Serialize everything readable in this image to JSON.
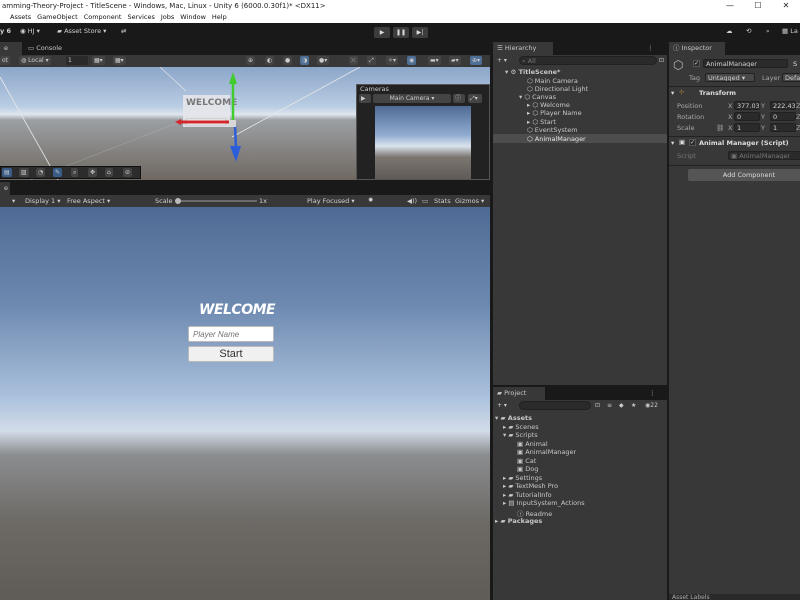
{
  "window": {
    "title": "amming-Theory-Project - TitleScene - Windows, Mac, Linux - Unity 6 (6000.0.30f1)* <DX11>",
    "controls": [
      "—",
      "☐",
      "✕"
    ]
  },
  "menu": [
    "Assets",
    "GameObject",
    "Component",
    "Services",
    "Jobs",
    "Window",
    "Help"
  ],
  "toolbar": {
    "app_label": "y 6",
    "account": "HJ",
    "asset_store": "Asset Store",
    "right_text": "La"
  },
  "scene_tabs": {
    "first": "e",
    "console": "Console"
  },
  "scene_controls": {
    "pivot": "ot",
    "space": "Local",
    "snap_value": "1"
  },
  "scene": {
    "sign_text": "WELCOME",
    "cameras_title": "Cameras",
    "camera_select": "Main Camera"
  },
  "game_tab": "e",
  "game_controls": {
    "display": "Display 1",
    "aspect": "Free Aspect",
    "scale_label": "Scale",
    "scale_value": "1x",
    "play_mode": "Play Focused",
    "stats": "Stats",
    "gizmos": "Gizmos"
  },
  "game": {
    "welcome": "WELCOME",
    "name_placeholder": "Player Name",
    "start_button": "Start"
  },
  "hierarchy": {
    "tab": "Hierarchy",
    "search_placeholder": "All",
    "items": [
      {
        "label": "TitleScene*"
      },
      {
        "label": "Main Camera"
      },
      {
        "label": "Directional Light"
      },
      {
        "label": "Canvas"
      },
      {
        "label": "Welcome"
      },
      {
        "label": "Player Name"
      },
      {
        "label": "Start"
      },
      {
        "label": "EventSystem"
      },
      {
        "label": "AnimalManager"
      }
    ]
  },
  "project": {
    "tab": "Project",
    "count": "22",
    "items": [
      {
        "label": "Assets"
      },
      {
        "label": "Scenes"
      },
      {
        "label": "Scripts"
      },
      {
        "label": "Animal"
      },
      {
        "label": "AnimalManager"
      },
      {
        "label": "Cat"
      },
      {
        "label": "Dog"
      },
      {
        "label": "Settings"
      },
      {
        "label": "TextMesh Pro"
      },
      {
        "label": "TutorialInfo"
      },
      {
        "label": "InputSystem_Actions"
      },
      {
        "label": "Readme"
      },
      {
        "label": "Packages"
      }
    ]
  },
  "inspector": {
    "tab": "Inspector",
    "object_name": "AnimalManager",
    "static_cut": "S",
    "tag_label": "Tag",
    "tag_value": "Untagged",
    "layer_label": "Layer",
    "layer_value": "Defau",
    "transform_title": "Transform",
    "position_label": "Position",
    "rotation_label": "Rotation",
    "scale_label": "Scale",
    "x": "X",
    "y": "Y",
    "z": "Z",
    "position": {
      "x": "377.03",
      "y": "222.43"
    },
    "rotation": {
      "x": "0",
      "y": "0"
    },
    "scale": {
      "x": "1",
      "y": "1"
    },
    "script_component_title": "Animal Manager (Script)",
    "script_label": "Script",
    "script_value": "AnimalManager",
    "add_component": "Add Component",
    "asset_labels": "Asset Labels"
  },
  "colors": {
    "accent_selection": "#2c5d87",
    "panel_bg": "#383838",
    "toolbar_bg": "#191919",
    "strip_bg": "#282828"
  }
}
